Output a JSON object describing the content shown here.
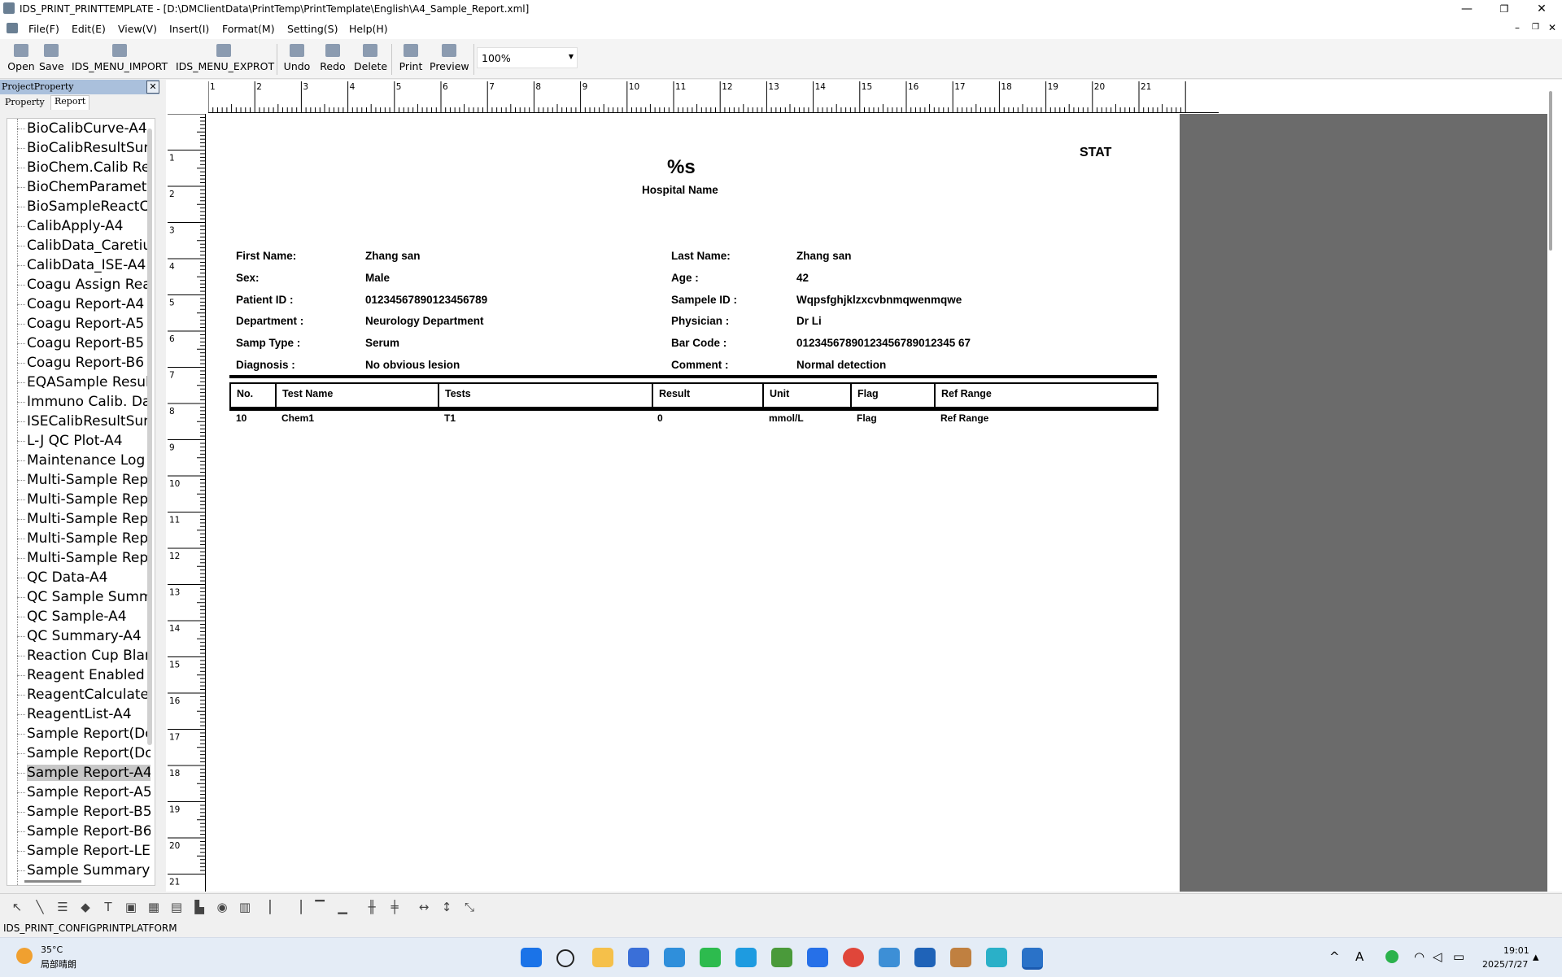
{
  "window": {
    "title": "IDS_PRINT_PRINTTEMPLATE - [D:\\DMClientData\\PrintTemp\\PrintTemplate\\English\\A4_Sample_Report.xml]",
    "controls": {
      "minimize": "—",
      "maximize": "❐",
      "close": "✕"
    },
    "mdi_controls": {
      "minimize": "–",
      "restore": "❐",
      "close": "✕"
    }
  },
  "menu": [
    "File(F)",
    "Edit(E)",
    "View(V)",
    "Insert(I)",
    "Format(M)",
    "Setting(S)",
    "Help(H)"
  ],
  "toolbar": {
    "open": "Open",
    "save": "Save",
    "import": "IDS_MENU_IMPORT",
    "export": "IDS_MENU_EXPROT",
    "undo": "Undo",
    "redo": "Redo",
    "delete": "Delete",
    "print": "Print",
    "preview": "Preview",
    "zoom": "100%"
  },
  "panel": {
    "title": "ProjectProperty",
    "close": "✕",
    "tabs": [
      "Property",
      "Report"
    ],
    "active_tab": "Report",
    "items": [
      "BioCalibCurve-A4",
      "BioCalibResultSummary",
      "BioChem.Calib Reagent",
      "BioChemParameter",
      "BioSampleReactCurve",
      "CalibApply-A4",
      "CalibData_Caretium",
      "CalibData_ISE-A4",
      "Coagu Assign Reagent",
      "Coagu Report-A4",
      "Coagu Report-A5",
      "Coagu Report-B5",
      "Coagu Report-B6",
      "EQASample Result",
      "Immuno Calib. Data",
      "ISECalibResultSummary",
      "L-J QC Plot-A4",
      "Maintenance Log Report",
      "Multi-Sample Report",
      "Multi-Sample Report",
      "Multi-Sample Report",
      "Multi-Sample Report",
      "Multi-Sample Report",
      "QC Data-A4",
      "QC Sample Summary",
      "QC Sample-A4",
      "QC Summary-A4",
      "Reaction Cup Blank",
      "Reagent Enabled Report",
      "ReagentCalculateList",
      "ReagentList-A4",
      "Sample Report(Double)",
      "Sample Report(Double)",
      "Sample Report-A4",
      "Sample Report-A5",
      "Sample Report-B5",
      "Sample Report-B6",
      "Sample Report-LETTER",
      "Sample Summary Report"
    ],
    "selected_index": 33
  },
  "ruler": {
    "h": [
      "1",
      "2",
      "3",
      "4",
      "5",
      "6",
      "7",
      "8",
      "9",
      "10",
      "11",
      "12",
      "13",
      "14",
      "15",
      "16",
      "17",
      "18",
      "19",
      "20",
      "21"
    ],
    "v": [
      "1",
      "2",
      "3",
      "4",
      "5",
      "6",
      "7",
      "8",
      "9",
      "10",
      "11",
      "12",
      "13",
      "14",
      "15",
      "16",
      "17",
      "18",
      "19",
      "20",
      "21"
    ]
  },
  "report": {
    "stat": "STAT",
    "title": "%s",
    "hospital": "Hospital Name",
    "fields_left": [
      {
        "label": "First Name:",
        "value": "Zhang san"
      },
      {
        "label": "Sex:",
        "value": "Male"
      },
      {
        "label": "Patient ID :",
        "value": "01234567890123456789"
      },
      {
        "label": "Department :",
        "value": "Neurology Department"
      },
      {
        "label": "Samp Type :",
        "value": "Serum"
      },
      {
        "label": "Diagnosis :",
        "value": "No obvious lesion"
      }
    ],
    "fields_right": [
      {
        "label": "Last Name:",
        "value": "Zhang san"
      },
      {
        "label": "Age :",
        "value": "42"
      },
      {
        "label": "Sampele ID :",
        "value": "Wqpsfghjklzxcvbnmqwenmqwe"
      },
      {
        "label": "Physician :",
        "value": "Dr Li"
      },
      {
        "label": "Bar Code :",
        "value": "01234567890123456789012345 67"
      },
      {
        "label": "Comment :",
        "value": "Normal detection"
      }
    ],
    "table_headers": [
      "No.",
      "Test Name",
      "Tests",
      "Result",
      "Unit",
      "Flag",
      "Ref Range"
    ],
    "table_row": [
      "10",
      "Chem1",
      "T1",
      "0",
      "mmol/L",
      "Flag",
      "Ref Range"
    ]
  },
  "bottom_tools": [
    "pointer-icon",
    "line-icon",
    "stack-icon",
    "tag-icon",
    "text-icon",
    "image-icon",
    "grid-icon",
    "table-icon",
    "chart-icon",
    "logo-icon",
    "barcode-icon",
    "align-left-icon",
    "align-right-icon",
    "align-top-icon",
    "align-bottom-icon",
    "center-h-icon",
    "center-v-icon",
    "same-width-icon",
    "same-height-icon",
    "same-size-icon"
  ],
  "status": "IDS_PRINT_CONFIGPRINTPLATFORM",
  "taskbar": {
    "weather_temp": "35°C",
    "weather_desc": "局部晴朗",
    "time": "19:01",
    "date": "2025/7/27",
    "ime": "A"
  }
}
